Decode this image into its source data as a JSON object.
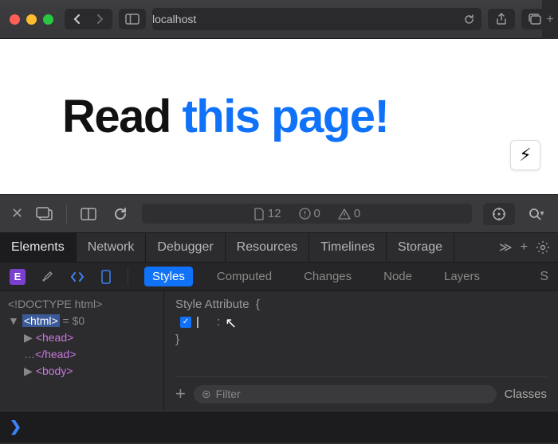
{
  "browser": {
    "address": "localhost"
  },
  "page": {
    "heading_black": "Read ",
    "heading_blue": "this page!",
    "lightning": "⚡︎"
  },
  "devtools": {
    "counters": {
      "resources": "12",
      "errors": "0",
      "warnings": "0"
    },
    "tabs": [
      "Elements",
      "Network",
      "Debugger",
      "Resources",
      "Timelines",
      "Storage"
    ],
    "tabs_overflow": "≫",
    "e_badge": "E",
    "sub_tabs": [
      "Styles",
      "Computed",
      "Changes",
      "Node",
      "Layers"
    ],
    "dom": {
      "doctype": "<!DOCTYPE html>",
      "html_open": "<html>",
      "eq0": " = $0",
      "head_open": "<head>",
      "head_close": "</head>",
      "body_open": "<body>"
    },
    "styles": {
      "attr_label": "Style Attribute",
      "brace_open": "{",
      "colon": ":",
      "brace_close": "}",
      "filter_placeholder": "Filter",
      "classes_label": "Classes"
    },
    "search_letter": "S"
  },
  "console": {
    "prompt": "❯"
  }
}
